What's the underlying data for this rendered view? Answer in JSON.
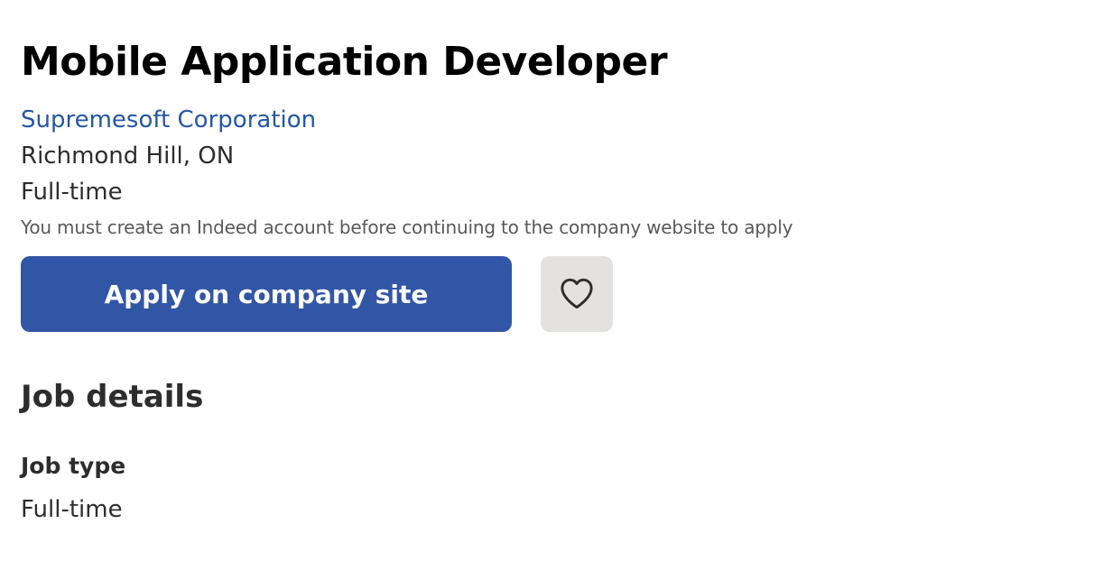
{
  "header": {
    "job_title": "Mobile Application Developer",
    "company_name": "Supremesoft Corporation",
    "location": "Richmond Hill, ON",
    "job_type": "Full-time",
    "account_notice": "You must create an Indeed account before continuing to the company website to apply"
  },
  "actions": {
    "apply_label": "Apply on company site",
    "save_icon": "heart-outline-icon",
    "apply_color": "#3256a6",
    "save_bg_color": "#e4e2e0"
  },
  "job_details": {
    "heading": "Job details",
    "job_type_label": "Job type",
    "job_type_value": "Full-time"
  },
  "colors": {
    "link": "#2557a7",
    "text": "#2d2d2d",
    "muted": "#595959"
  }
}
